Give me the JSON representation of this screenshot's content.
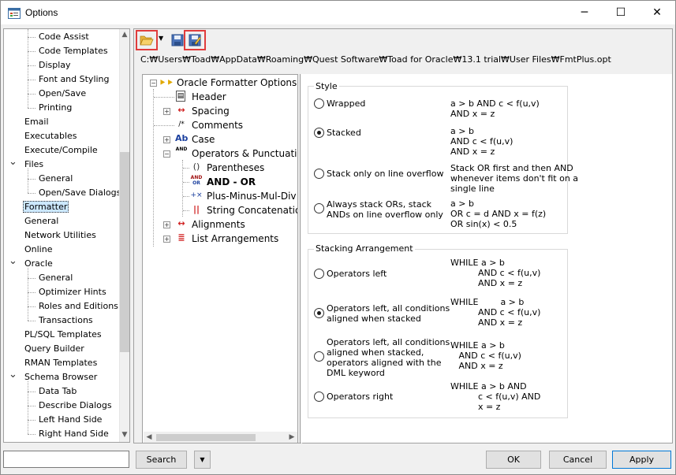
{
  "window": {
    "title": "Options",
    "minimize_glyph": "─",
    "maximize_glyph": "☐",
    "close_glyph": "✕"
  },
  "nav": {
    "items": [
      {
        "label": "Code Assist",
        "level": 2
      },
      {
        "label": "Code Templates",
        "level": 2
      },
      {
        "label": "Display",
        "level": 2
      },
      {
        "label": "Font and Styling",
        "level": 2
      },
      {
        "label": "Open/Save",
        "level": 2
      },
      {
        "label": "Printing",
        "level": 2
      },
      {
        "label": "Email",
        "level": 1
      },
      {
        "label": "Executables",
        "level": 1
      },
      {
        "label": "Execute/Compile",
        "level": 1
      },
      {
        "label": "Files",
        "level": 1,
        "expanded": true
      },
      {
        "label": "General",
        "level": 2
      },
      {
        "label": "Open/Save Dialogs",
        "level": 2
      },
      {
        "label": "Formatter",
        "level": 1,
        "selected": true
      },
      {
        "label": "General",
        "level": 1
      },
      {
        "label": "Network Utilities",
        "level": 1
      },
      {
        "label": "Online",
        "level": 1
      },
      {
        "label": "Oracle",
        "level": 1,
        "expanded": true
      },
      {
        "label": "General",
        "level": 2
      },
      {
        "label": "Optimizer Hints",
        "level": 2
      },
      {
        "label": "Roles and Editions",
        "level": 2
      },
      {
        "label": "Transactions",
        "level": 2
      },
      {
        "label": "PL/SQL Templates",
        "level": 1
      },
      {
        "label": "Query Builder",
        "level": 1
      },
      {
        "label": "RMAN Templates",
        "level": 1
      },
      {
        "label": "Schema Browser",
        "level": 1,
        "expanded": true
      },
      {
        "label": "Data Tab",
        "level": 2
      },
      {
        "label": "Describe Dialogs",
        "level": 2
      },
      {
        "label": "Left Hand Side",
        "level": 2
      },
      {
        "label": "Right Hand Side",
        "level": 2
      }
    ]
  },
  "toolbar": {
    "file_path": "C:₩Users₩Toad₩AppData₩Roaming₩Quest Software₩Toad for Oracle₩13.1 trial₩User Files₩FmtPlus.opt"
  },
  "formatter_tree": {
    "root": "Oracle Formatter Options",
    "nodes": [
      {
        "label": "Header"
      },
      {
        "label": "Spacing"
      },
      {
        "label": "Comments"
      },
      {
        "label": "Case"
      },
      {
        "label": "Operators & Punctuation"
      },
      {
        "label": "Parentheses"
      },
      {
        "label": "AND - OR",
        "bold": true
      },
      {
        "label": "Plus-Minus-Mul-Div"
      },
      {
        "label": "String Concatenation"
      },
      {
        "label": "Alignments"
      },
      {
        "label": "List Arrangements"
      }
    ],
    "icon_glyphs": {
      "header": "▤",
      "spacing": "↔",
      "comments": "/*",
      "case": "Ab",
      "operators": "AND",
      "parentheses": "()",
      "and_or_top": "AND",
      "and_or_bottom": "OR",
      "plus": "+×",
      "concat": "||",
      "alignments": "↔",
      "lists": "≣"
    }
  },
  "style_group": {
    "title": "Style",
    "options": [
      {
        "label": "Wrapped",
        "checked": false,
        "sample": "a > b AND c < f(u,v)\nAND x = z"
      },
      {
        "label": "Stacked",
        "checked": true,
        "sample": "a > b\nAND c < f(u,v)\nAND x = z"
      },
      {
        "label": "Stack only on line overflow",
        "checked": false,
        "sample": "Stack OR first and then AND\nwhenever items don't fit on a\nsingle line"
      },
      {
        "label": "Always stack ORs, stack\nANDs on line overflow only",
        "checked": false,
        "sample": "a > b\nOR c = d AND x = f(z)\nOR sin(x) < 0.5"
      }
    ]
  },
  "stacking_group": {
    "title": "Stacking Arrangement",
    "options": [
      {
        "label": "Operators left",
        "checked": false,
        "sample": "WHILE a > b\n          AND c < f(u,v)\n          AND x = z"
      },
      {
        "label": "Operators left, all conditions\naligned when stacked",
        "checked": true,
        "sample": "WHILE        a > b\n          AND c < f(u,v)\n          AND x = z"
      },
      {
        "label": "Operators left, all conditions\naligned when stacked,\noperators aligned with the\nDML keyword",
        "checked": false,
        "sample": "WHILE a > b\n   AND c < f(u,v)\n   AND x = z"
      },
      {
        "label": "Operators right",
        "checked": false,
        "sample": "WHILE a > b AND\n          c < f(u,v) AND\n          x = z"
      }
    ]
  },
  "bottom": {
    "search_value": "",
    "search_label": "Search",
    "dropdown_glyph": "▼",
    "ok_label": "OK",
    "cancel_label": "Cancel",
    "apply_label": "Apply"
  }
}
